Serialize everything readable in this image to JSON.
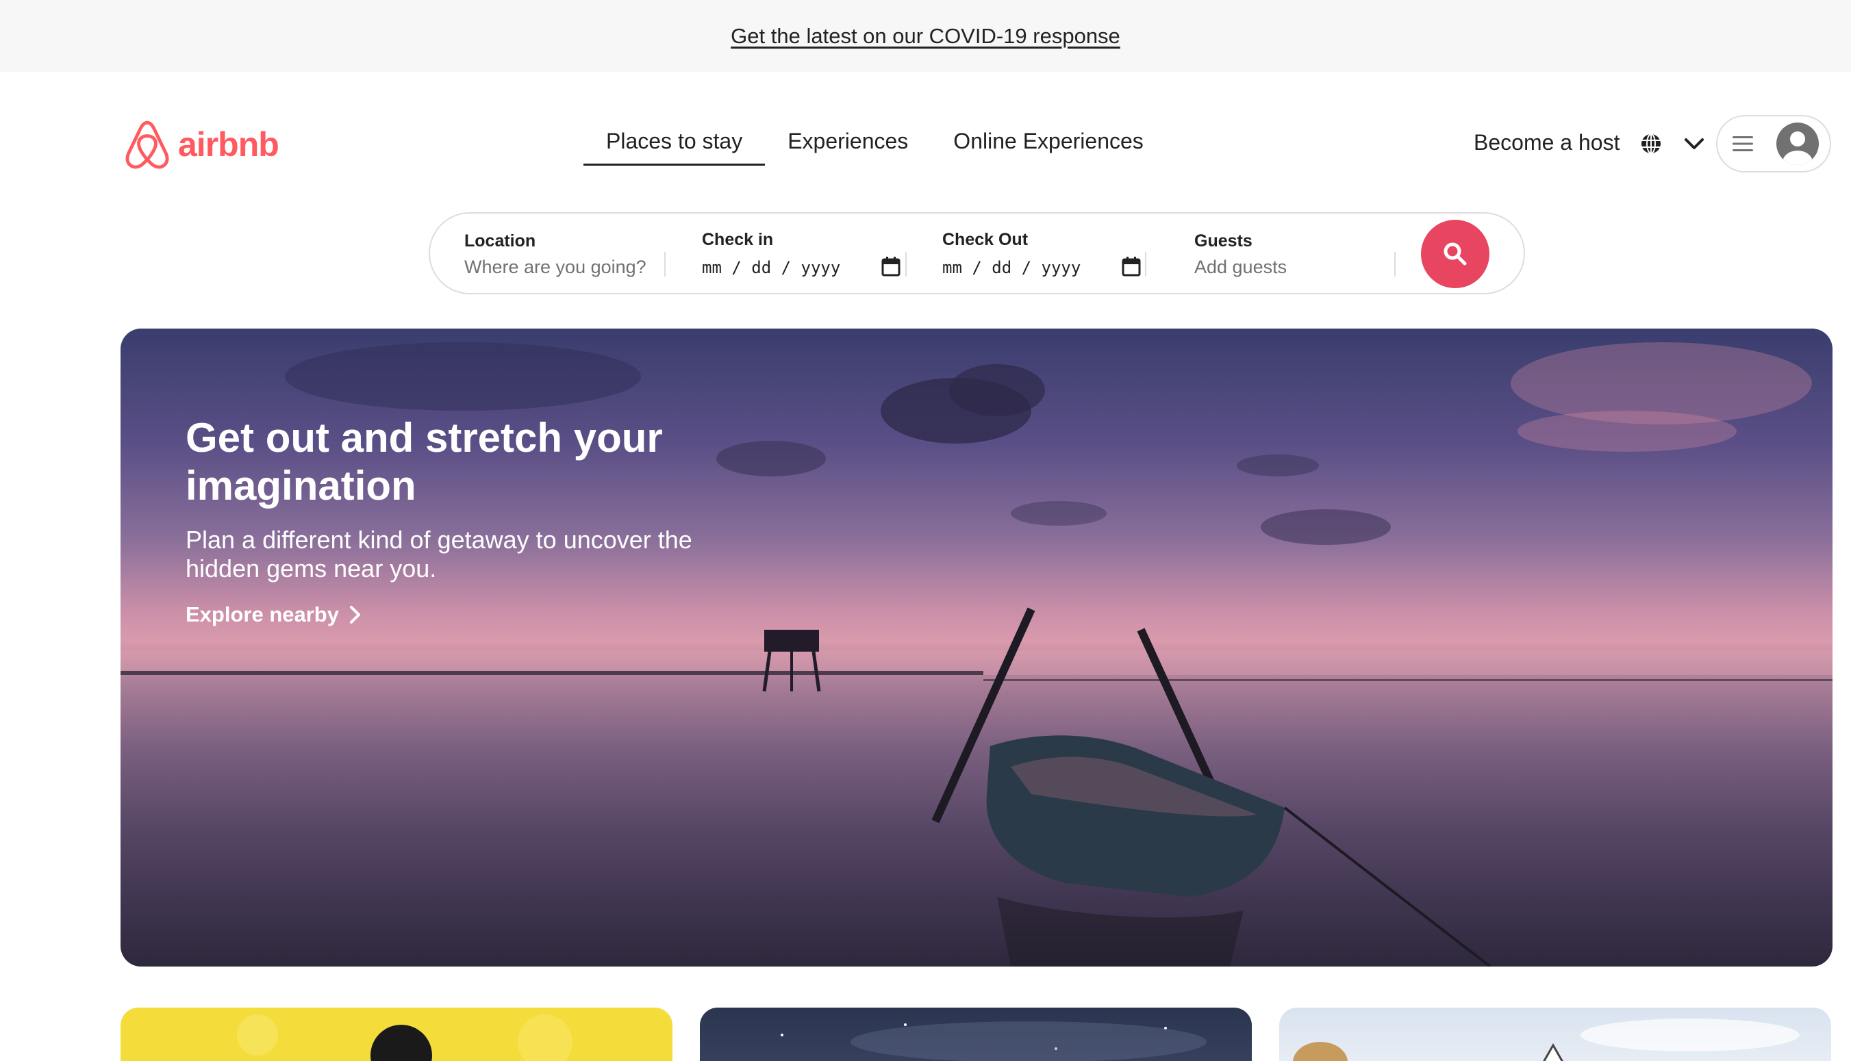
{
  "banner": {
    "link_text": "Get the latest on our COVID-19 response"
  },
  "header": {
    "logo_text": "airbnb",
    "brand_color": "#ff5a5f",
    "nav": [
      {
        "label": "Places to stay",
        "active": true
      },
      {
        "label": "Experiences",
        "active": false
      },
      {
        "label": "Online Experiences",
        "active": false
      }
    ],
    "host_link": "Become a host",
    "globe_icon": "globe-icon",
    "chevron_icon": "chevron-down-icon",
    "menu_icon": "hamburger-icon",
    "avatar_icon": "user-avatar-icon"
  },
  "search": {
    "location": {
      "label": "Location",
      "placeholder": "Where are you going?"
    },
    "check_in": {
      "label": "Check in",
      "value": "mm / dd / yyyy"
    },
    "check_out": {
      "label": "Check Out",
      "value": "mm / dd / yyyy"
    },
    "guests": {
      "label": "Guests",
      "placeholder": "Add guests"
    },
    "button_icon": "search-icon",
    "button_color": "#e84660"
  },
  "hero": {
    "title": "Get out and stretch your imagination",
    "subtitle": "Plan a different kind of getaway to uncover the hidden gems near you.",
    "link": "Explore nearby",
    "link_icon": "chevron-right-icon"
  },
  "cards": [
    {
      "name": "card-yellow",
      "color": "#f4dd3a"
    },
    {
      "name": "card-night-sky",
      "color": "#2b3550"
    },
    {
      "name": "card-sky",
      "color": "#d9e3ef"
    }
  ]
}
